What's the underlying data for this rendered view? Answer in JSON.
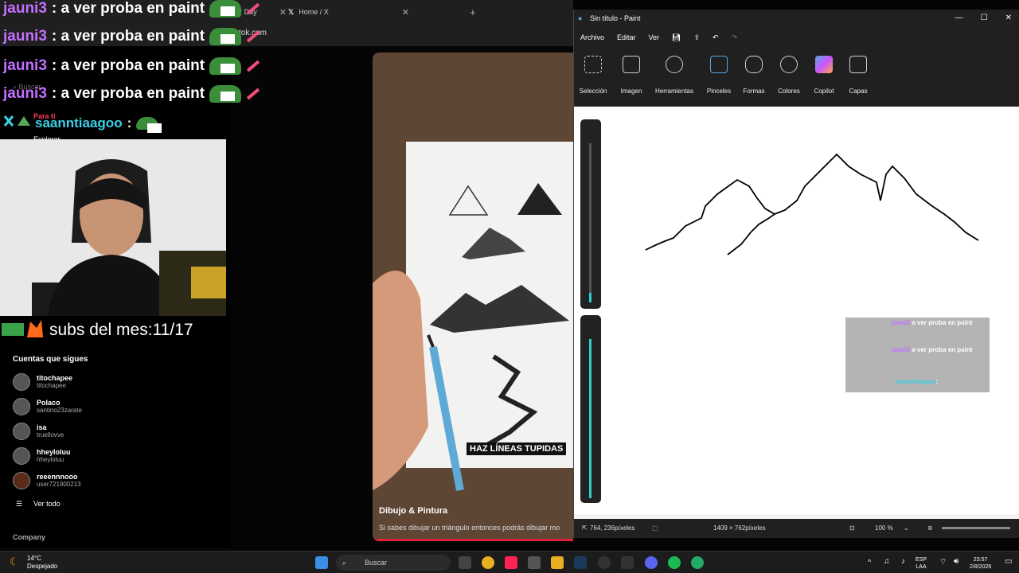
{
  "browser": {
    "tabs": [
      {
        "label": "Your Day"
      },
      {
        "label": "Home / X"
      }
    ],
    "address": "tiktok.com",
    "search_placeholder": "Buscar",
    "side_items": [
      "Para ti",
      "Explorar"
    ]
  },
  "chat_overlay": [
    {
      "user": "jauni3",
      "message": ": a ver proba en paint"
    },
    {
      "user": "jauni3",
      "message": ": a ver proba en paint"
    },
    {
      "user": "jauni3",
      "message": ": a ver proba en paint"
    },
    {
      "user": "jauni3",
      "message": ": a ver proba en paint"
    },
    {
      "user": "saanntiaagoo",
      "message": ":"
    }
  ],
  "subs_counter": "subs del mes:11/17",
  "following": {
    "title": "Cuentas que sigues",
    "accounts": [
      {
        "name": "titochapee",
        "handle": "titochapee"
      },
      {
        "name": "Polaco",
        "handle": "santino23zarate"
      },
      {
        "name": "isa",
        "handle": "truellovve"
      },
      {
        "name": "hheyloluu",
        "handle": "hheyloluu"
      },
      {
        "name": "reeennnooo",
        "handle": "user721900213"
      }
    ],
    "see_all": "Ver todo"
  },
  "company_label": "Company",
  "video": {
    "caption": "HAZ LÍNEAS TUPIDAS",
    "title": "Dibujo & Pintura",
    "description": "Si sabes dibujar un triángulo entonces podrás dibujar mo"
  },
  "paint": {
    "window_title": "Sin título - Paint",
    "menu": [
      "Archivo",
      "Editar",
      "Ver"
    ],
    "tools": [
      "Selección",
      "Imagen",
      "Herramientas",
      "Pinceles",
      "Formas",
      "Colores",
      "Copilot",
      "Capas"
    ],
    "status": {
      "cursor": "764, 236píxeles",
      "size": "1409 × 762píxeles",
      "zoom": "100 %"
    },
    "chat_popup": [
      {
        "user": "jauni3",
        "message": "a ver proba en paint"
      },
      {
        "user": "jauni3",
        "message": "a ver proba en paint"
      },
      {
        "user": "saanntiaagoo",
        "message": ":"
      }
    ]
  },
  "taskbar": {
    "temp": "14°C",
    "weather": "Despejado",
    "search": "Buscar",
    "lang": "ESP",
    "lang2": "LAA",
    "time": "23:57",
    "date": "2/8/2026"
  }
}
